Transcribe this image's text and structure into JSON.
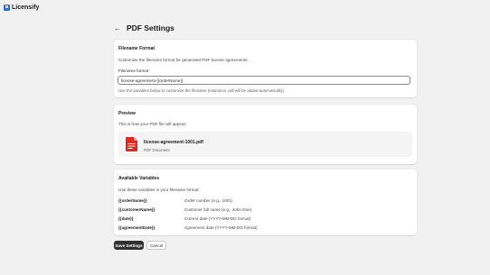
{
  "app": {
    "name": "Licensify"
  },
  "header": {
    "title": "PDF Settings"
  },
  "filename_card": {
    "title": "Filename Format",
    "description": "Customize the filename format for generated PDF license agreements.",
    "field_label": "Filename format",
    "field_value": "license-agreement-{{orderName}}",
    "help_text": "Use the variables below to customize the filename (extension .pdf will be added automatically)"
  },
  "preview_card": {
    "title": "Preview",
    "description": "This is how your PDF file will appear:",
    "file_name": "license-agreement-1001.pdf",
    "file_type": "PDF Document",
    "icon_color": "#e0281f"
  },
  "variables_card": {
    "title": "Available Variables",
    "description": "Use these variables in your filename format:",
    "variables": [
      {
        "name": "{{orderName}}",
        "description": "Order number (e.g., 1001)"
      },
      {
        "name": "{{customerName}}",
        "description": "Customer full name (e.g., John-Doe)"
      },
      {
        "name": "{{date}}",
        "description": "Current date (YYYY-MM-DD format)"
      },
      {
        "name": "{{agreementDate}}",
        "description": "Agreement date (YYYY-MM-DD format)"
      }
    ]
  },
  "actions": {
    "save_label": "Save Settings",
    "cancel_label": "Cancel"
  },
  "colors": {
    "background": "#f1f1f1",
    "logo": "#2c6ecb",
    "primary_button": "#303030"
  }
}
